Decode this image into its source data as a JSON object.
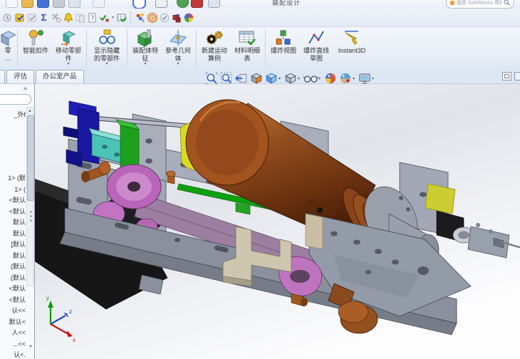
{
  "window": {
    "title_partial": "装配设计",
    "search_placeholder": "搜索 SolidWorks 帮助"
  },
  "quick_toolbar": {
    "icons": [
      "new-doc-icon",
      "open-folder-icon",
      "save-icon",
      "print-icon",
      "undo-icon",
      "redo-icon",
      "rebuild-icon",
      "select-icon",
      "options-icon",
      "color-swatch-icon",
      "window-icon"
    ]
  },
  "tools_toolbar": {
    "icons": [
      "history-icon",
      "design-checker-icon",
      "check-disabled-icon",
      "equations-sigma-icon",
      "no-external-ref-icon",
      "alert-bell-icon",
      "compare-disabled-icon",
      "help-doc-icon",
      "verify-check-x-icon",
      "dropdown",
      "table-evaluate-icon",
      "appearance-paint-icon",
      "motion-rings-icon",
      "check-circle-icon",
      "deviation-blocks-icon",
      "render-sphere-icon"
    ],
    "dropdown_glyph": "▾"
  },
  "ribbon": {
    "partial": {
      "line1": "零",
      "line2": "…"
    },
    "dropdown_glyph": "▾",
    "buttons": [
      {
        "label": "智能扣件",
        "dropdown": false
      },
      {
        "label": "移动零部件",
        "dropdown": true
      },
      {
        "label": "显示隐藏的零部件",
        "dropdown": true
      },
      {
        "label": "装配体特征",
        "dropdown": true
      },
      {
        "label": "参考几何体",
        "dropdown": true
      },
      {
        "label": "新建运动算例",
        "dropdown": false
      },
      {
        "label": "材料明细表",
        "dropdown": false
      },
      {
        "label": "爆炸视图",
        "dropdown": false
      },
      {
        "label": "爆炸直线草图",
        "dropdown": false
      },
      {
        "label": "Instant3D",
        "dropdown": false
      }
    ]
  },
  "tabs": {
    "evaluate": "评估",
    "office_products": "办公室产品"
  },
  "feature_panel": {
    "chevron": "»",
    "header_fragment": "_外f",
    "scroll_up": "▲",
    "scroll_down": "▼",
    "items": [
      "1> (默",
      "1> (",
      "<默认",
      "<默认",
      "默认",
      "默认",
      "[默认",
      "默认",
      "(默认",
      "(默认",
      "<默认",
      "<默认",
      "认<<",
      "默认<",
      "人<<",
      "...<<",
      "认<."
    ]
  },
  "viewport": {
    "heads_up_icons": [
      "zoom-fit-icon",
      "zoom-area-icon",
      "previous-view-icon",
      "section-view-icon",
      "view-orientation-icon",
      "display-style-icon",
      "hide-show-items-icon",
      "edit-appearance-icon",
      "apply-scene-icon",
      "view-settings-icon"
    ],
    "restore_window_icon": "restore-icon",
    "triad": {
      "x": "x",
      "y": "y",
      "z": "z"
    },
    "model_parts": [
      "frame-rails",
      "motor-cylinder",
      "blue-bracket",
      "teal-block",
      "green-brackets",
      "yellow-brackets",
      "magenta-pulley",
      "purple-belt",
      "black-plate",
      "tan-hook-bracket",
      "brown-knob",
      "right-bracket-needle"
    ]
  },
  "colors": {
    "accent_blue": "#3a6bbf",
    "motor_brown": "#8a431a",
    "pulley_magenta": "#b965b9",
    "belt_purple": "#9c7fa0",
    "bracket_blue": "#1818a0",
    "part_green": "#1da11d",
    "part_yellow": "#d9d923",
    "part_teal": "#4cc3b8"
  }
}
